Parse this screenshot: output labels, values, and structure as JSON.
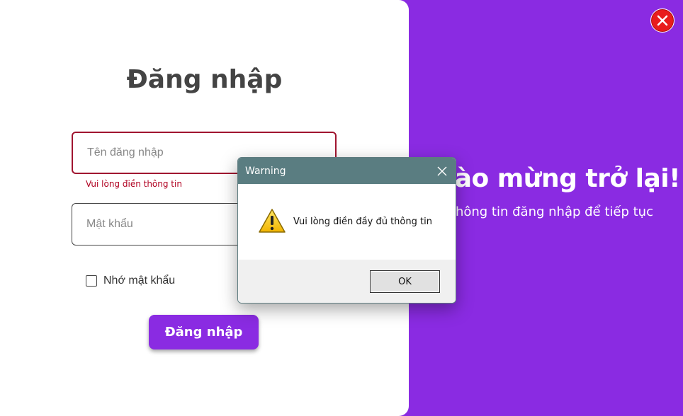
{
  "welcome": {
    "title": "hào mừng trở lại!",
    "subtitle": "ập thông tin đăng nhập để tiếp tục"
  },
  "login": {
    "title": "Đăng nhập",
    "username_placeholder": "Tên đăng nhập",
    "username_error": "Vui lòng điền thông tin",
    "password_placeholder": "Mật khẩu",
    "remember_label": "Nhớ mật khẩu",
    "submit_label": "Đăng nhập"
  },
  "dialog": {
    "title": "Warning",
    "message": "Vui lòng điền đầy đủ thông tin",
    "ok_label": "OK",
    "icon": "warning-icon"
  },
  "colors": {
    "accent": "#8a2be2",
    "error": "#b00020",
    "dialog_titlebar": "#5a7d81",
    "close_button": "#e81c1c"
  }
}
